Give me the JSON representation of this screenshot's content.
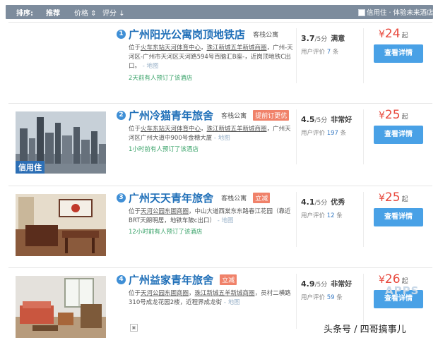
{
  "sort_bar": {
    "label": "排序:",
    "recommend": "推荐",
    "price": "价格",
    "price_arrow": "⇕",
    "rating": "评分",
    "rating_arrow": "↓",
    "filter_text": "信用住 · 体验未来酒店"
  },
  "hotels": [
    {
      "index": "1",
      "name": "广州阳光公寓岗顶地铁店",
      "type": "客栈公寓",
      "tag": "",
      "addr_prefix": "位于",
      "addr_link1": "火车东站天河体育中心",
      "addr_sep": "，",
      "addr_link2": "珠江新城五羊新城商圈",
      "addr_rest": "，广州-天河区-广州市天河区天河路594号百脑汇B座-，近岗顶地铁C出口。",
      "map": " - 地图",
      "booked": "2天前有人预订了该酒店",
      "score": "3.7",
      "score_max": "/5分",
      "grade": "满意",
      "reviews_prefix": "用户评价",
      "reviews_count": "7",
      "reviews_suffix": "条",
      "price_currency": "¥",
      "price": "24",
      "price_suffix": "起",
      "button": "查看详情",
      "credit_tag": ""
    },
    {
      "index": "2",
      "name": "广州冷猫青年旅舍",
      "type": "客栈公寓",
      "tag": "提前订更优",
      "addr_prefix": "位于",
      "addr_link1": "火车东站天河体育中心",
      "addr_sep": "，",
      "addr_link2": "珠江新城五羊新城商圈",
      "addr_rest": "，广州天河区广州大道中900号金穗大厦",
      "map": " - 地图",
      "booked": "1小时前有人预订了该酒店",
      "score": "4.5",
      "score_max": "/5分",
      "grade": "非常好",
      "reviews_prefix": "用户评价",
      "reviews_count": "197",
      "reviews_suffix": "条",
      "price_currency": "¥",
      "price": "25",
      "price_suffix": "起",
      "button": "查看详情",
      "credit_tag": "信用住"
    },
    {
      "index": "3",
      "name": "广州天天青年旅舍",
      "type": "客栈公寓",
      "tag": "立减",
      "addr_prefix": "位于",
      "addr_link1": "天河公园东圃商圈",
      "addr_sep": "，",
      "addr_link2": "",
      "addr_rest": "中山大道西棠东东路春江花园（靠近BRT天朗明居，地铁车陂c出口）",
      "map": " - 地图",
      "booked": "12小时前有人预订了该酒店",
      "score": "4.1",
      "score_max": "/5分",
      "grade": "优秀",
      "reviews_prefix": "用户评价",
      "reviews_count": "12",
      "reviews_suffix": "条",
      "price_currency": "¥",
      "price": "25",
      "price_suffix": "起",
      "button": "查看详情",
      "credit_tag": ""
    },
    {
      "index": "4",
      "name": "广州益家青年旅舍",
      "type": "",
      "tag": "立减",
      "addr_prefix": "位于",
      "addr_link1": "天河公园东圃商圈",
      "addr_sep": "，",
      "addr_link2": "珠江新城五羊新城商圈",
      "addr_rest": "，员村二横路310号成龙花园2楼，近程界成龙街",
      "map": " - 地图",
      "booked": "",
      "score": "4.9",
      "score_max": "/5分",
      "grade": "非常好",
      "reviews_prefix": "用户评价",
      "reviews_count": "59",
      "reviews_suffix": "条",
      "price_currency": "¥",
      "price": "26",
      "price_suffix": "起",
      "button": "查看详情",
      "credit_tag": ""
    }
  ],
  "watermark": "头条号 / 四哥搞事儿",
  "watermark_ghost": "APPS",
  "colors": {
    "accent_blue": "#1f6fb8",
    "button_blue": "#49a1e6",
    "price_red": "#e8483c",
    "sortbar": "#7d8c9d",
    "booked_green": "#3aa36a"
  }
}
